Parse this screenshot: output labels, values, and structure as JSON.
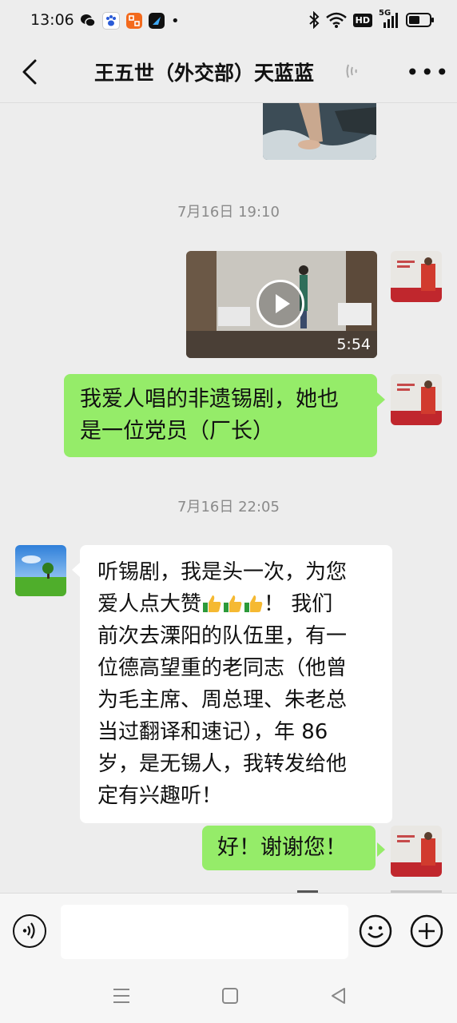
{
  "status_bar": {
    "time": "13:06",
    "apps": [
      "wechat-icon",
      "baidu-icon",
      "orange-app-icon",
      "dark-app-icon"
    ],
    "dot": "•",
    "right_icons": [
      "bluetooth-icon",
      "wifi-icon",
      "hd-icon",
      "signal-5g-icon",
      "battery-icon"
    ],
    "hd_label": "HD",
    "net_label": "5G"
  },
  "header": {
    "title": "王五世（外交部）天蓝蓝",
    "more": "•••"
  },
  "chat": {
    "timestamps": [
      "7月16日 19:10",
      "7月16日 22:05"
    ],
    "video": {
      "duration": "5:54"
    },
    "messages": [
      {
        "side": "right",
        "text_lines": [
          "我爱人唱的非遗锡剧，她也",
          "是一位党员（厂长）"
        ]
      },
      {
        "side": "left",
        "text_lines": [
          "听锡剧，我是头一次，为您",
          "爱人点大赞",
          "！ 我们",
          "前次去溧阳的队伍里，有一",
          "位德高望重的老同志（他曾",
          "为毛主席、周总理、朱老总",
          "当过翻译和速记），年 86",
          "岁，是无锡人，我转发给他",
          "定有兴趣听！"
        ]
      },
      {
        "side": "right",
        "text_lines": [
          "好！谢谢您！"
        ]
      }
    ]
  },
  "colors": {
    "accent_green": "#95ec69",
    "background": "#ededed"
  },
  "input_bar": {
    "placeholder": ""
  }
}
